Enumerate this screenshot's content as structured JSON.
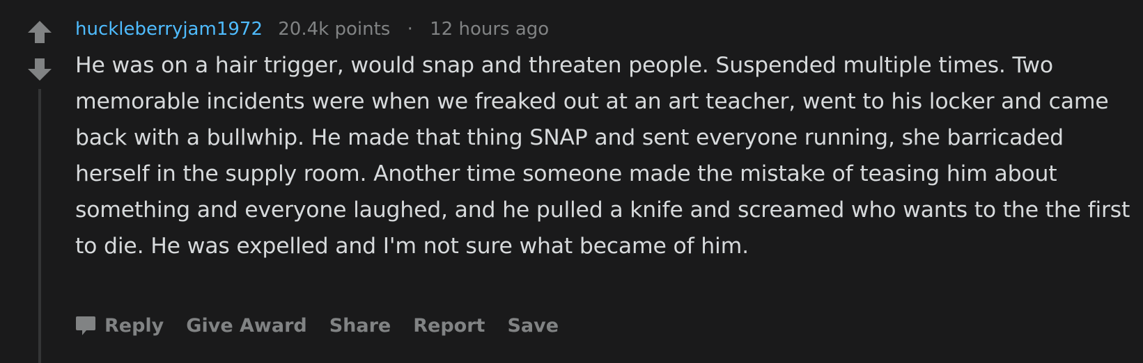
{
  "comment": {
    "author": "huckleberryjam1972",
    "points": "20.4k points",
    "separator": "·",
    "time": "12 hours ago",
    "body": "He was on a hair trigger, would snap and threaten people. Suspended multiple times. Two memorable incidents were when we freaked out at an art teacher, went to his locker and came back with a bullwhip. He made that thing SNAP and sent everyone running, she barricaded herself in the supply room. Another time someone made the mistake of teasing him about something and everyone laughed, and he pulled a knife and screamed who wants to the the first to die. He was expelled and I'm not sure what became of him."
  },
  "actions": {
    "reply": "Reply",
    "give_award": "Give Award",
    "share": "Share",
    "report": "Report",
    "save": "Save"
  },
  "icons": {
    "upvote": "arrow-up-icon",
    "downvote": "arrow-down-icon",
    "reply": "speech-bubble-icon"
  },
  "colors": {
    "background": "#1a1a1b",
    "username": "#4fbcff",
    "text": "#d7dadc",
    "muted": "#818384",
    "vote_arrow": "#818384",
    "thread_line": "#343536"
  }
}
